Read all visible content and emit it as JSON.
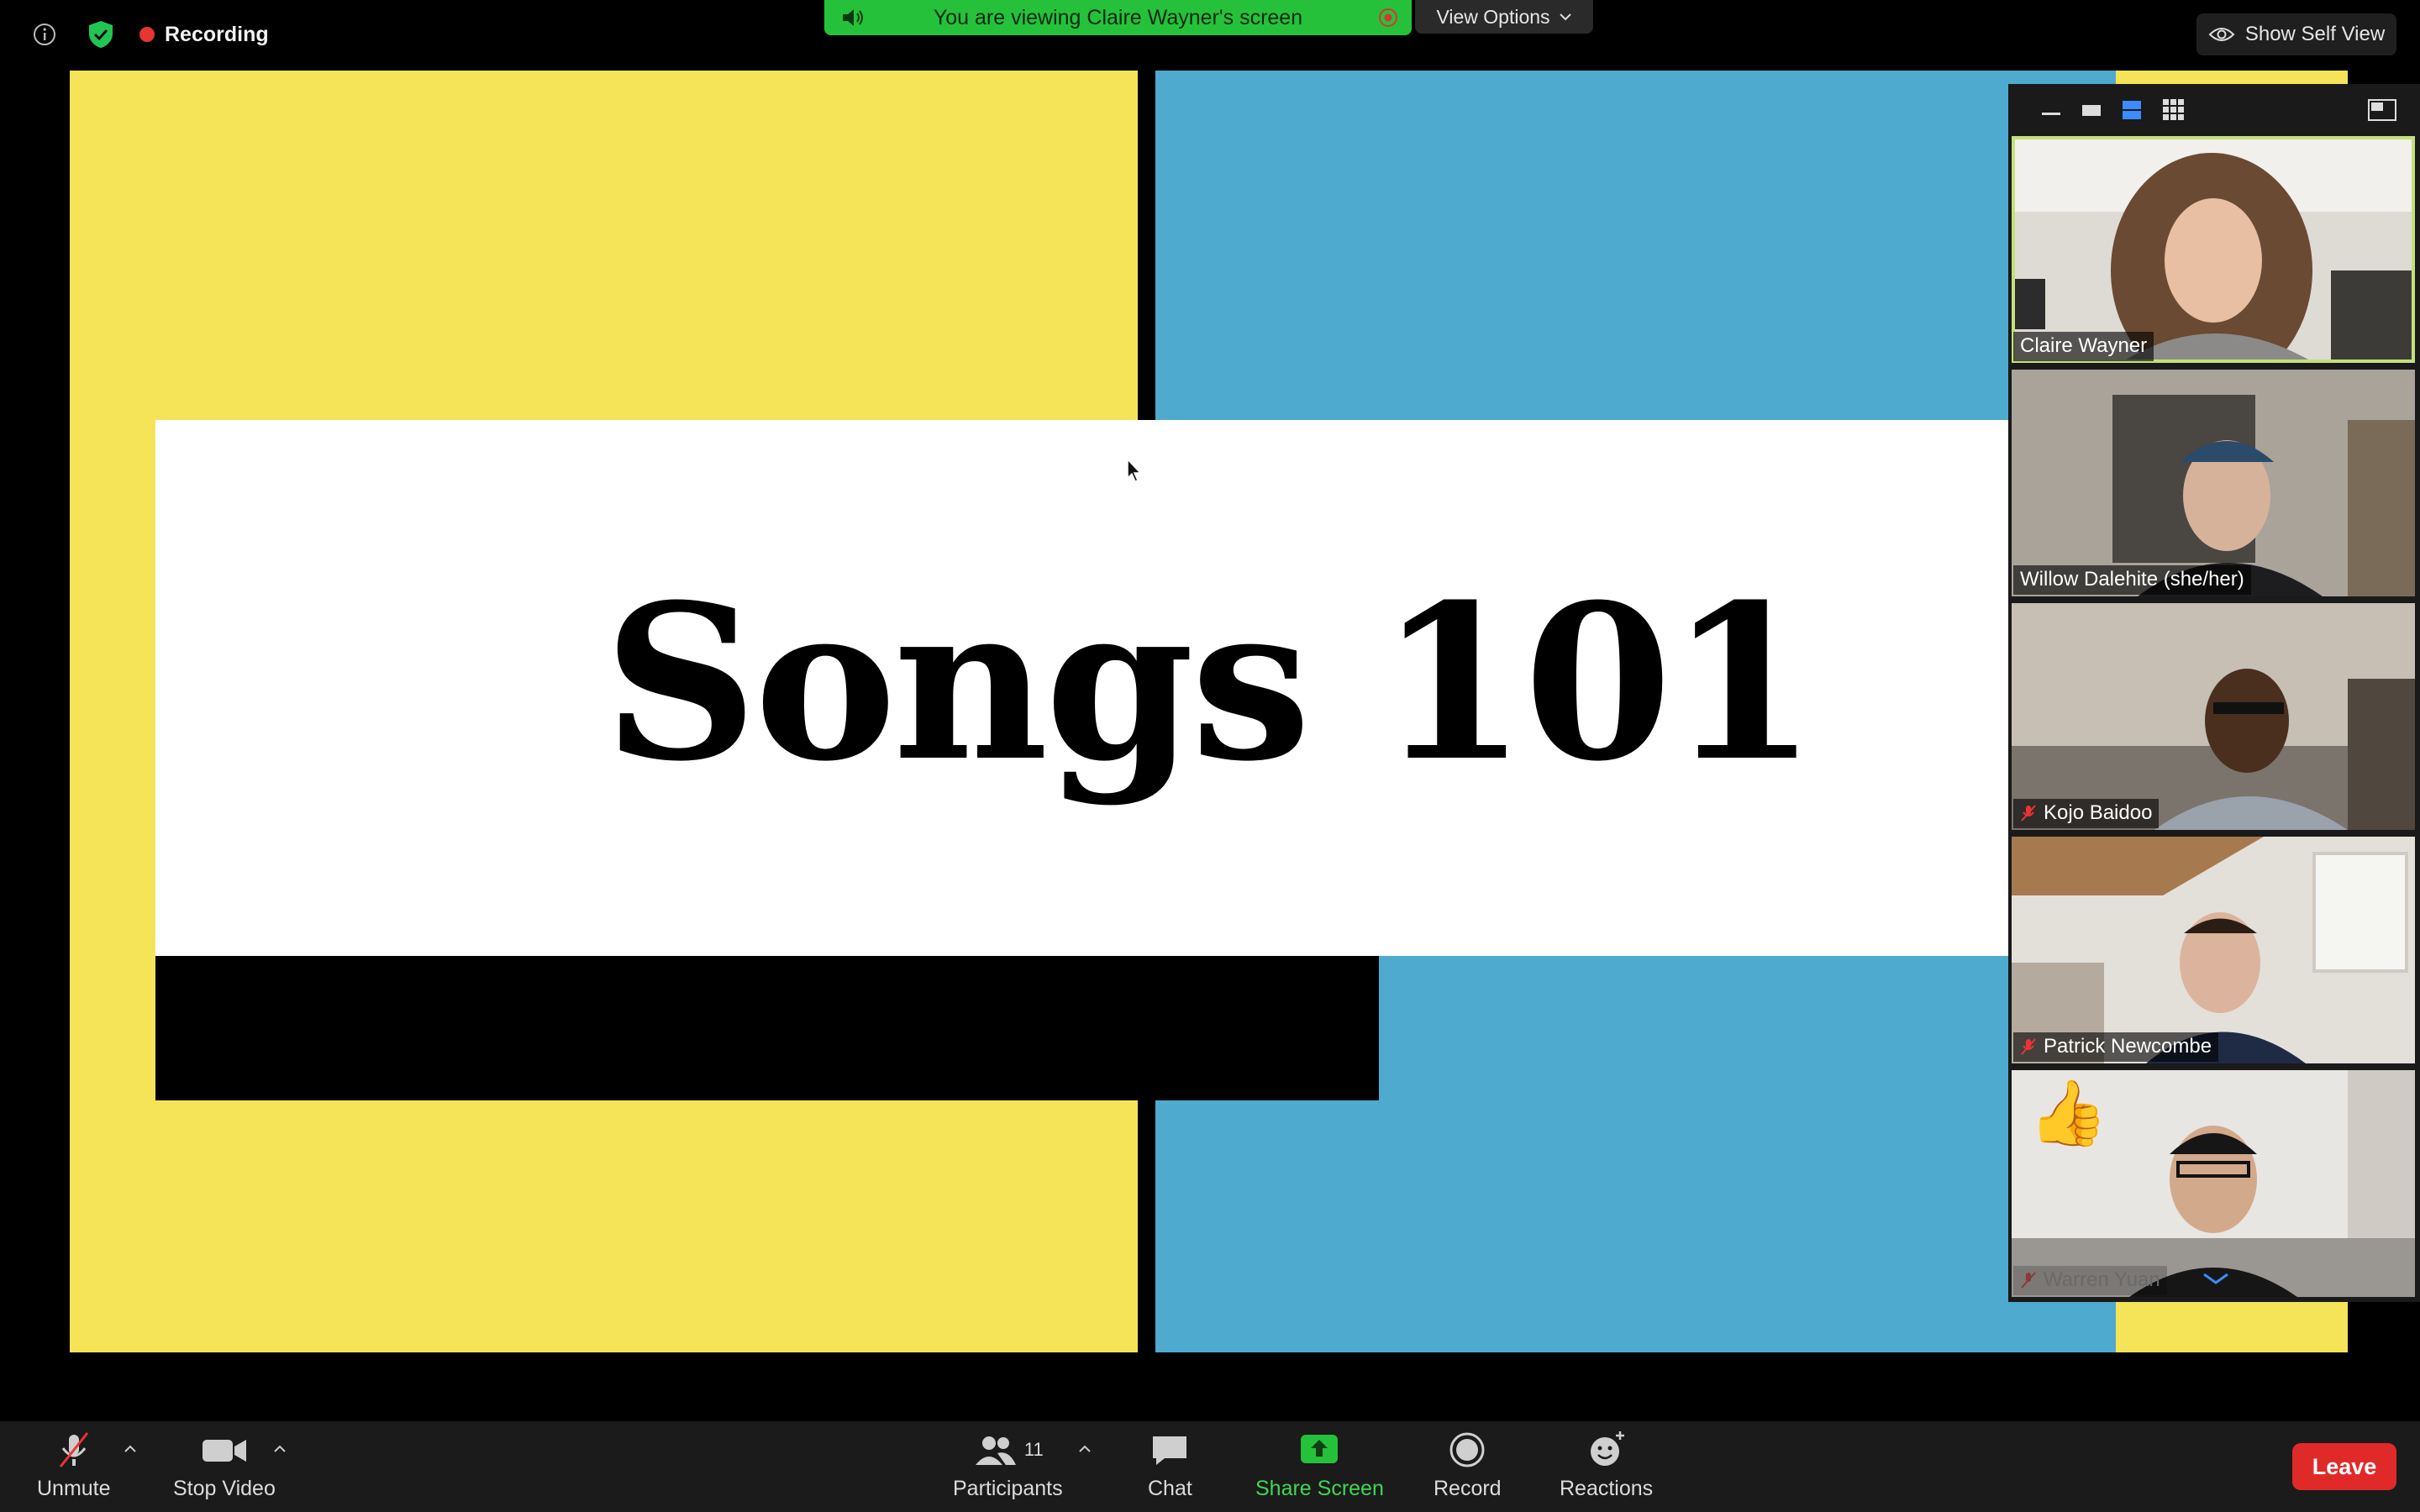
{
  "top_bar": {
    "recording_label": "Recording",
    "banner_text": "You are viewing Claire Wayner's screen",
    "view_options_label": "View Options",
    "self_view_label": "Show Self View"
  },
  "slide": {
    "title": "Songs 101",
    "colors": {
      "yellow": "#f5e458",
      "blue": "#4eaacf",
      "white": "#ffffff",
      "black": "#000000"
    }
  },
  "gallery": {
    "participants": [
      {
        "name": "Claire Wayner",
        "muted": false,
        "active": true
      },
      {
        "name": "Willow Dalehite (she/her)",
        "muted": false,
        "active": false
      },
      {
        "name": "Kojo Baidoo",
        "muted": true,
        "active": false
      },
      {
        "name": "Patrick Newcombe",
        "muted": true,
        "active": false
      },
      {
        "name": "Warren Yuan",
        "muted": true,
        "active": false,
        "reaction": "👍"
      }
    ]
  },
  "toolbar": {
    "unmute_label": "Unmute",
    "stop_video_label": "Stop Video",
    "participants_label": "Participants",
    "participants_count": "11",
    "chat_label": "Chat",
    "share_label": "Share Screen",
    "record_label": "Record",
    "reactions_label": "Reactions",
    "leave_label": "Leave"
  },
  "icons": [
    "info-icon",
    "shield-icon",
    "speaker-icon",
    "stop-share-icon",
    "chevron-down-icon",
    "eye-icon",
    "microphone-off-icon",
    "video-camera-icon",
    "participants-icon",
    "chat-icon",
    "share-screen-icon",
    "record-icon",
    "reactions-icon"
  ],
  "accent_colors": {
    "share_green": "#26c13a",
    "leave_red": "#e02a2a",
    "recording_red": "#e8352f"
  }
}
